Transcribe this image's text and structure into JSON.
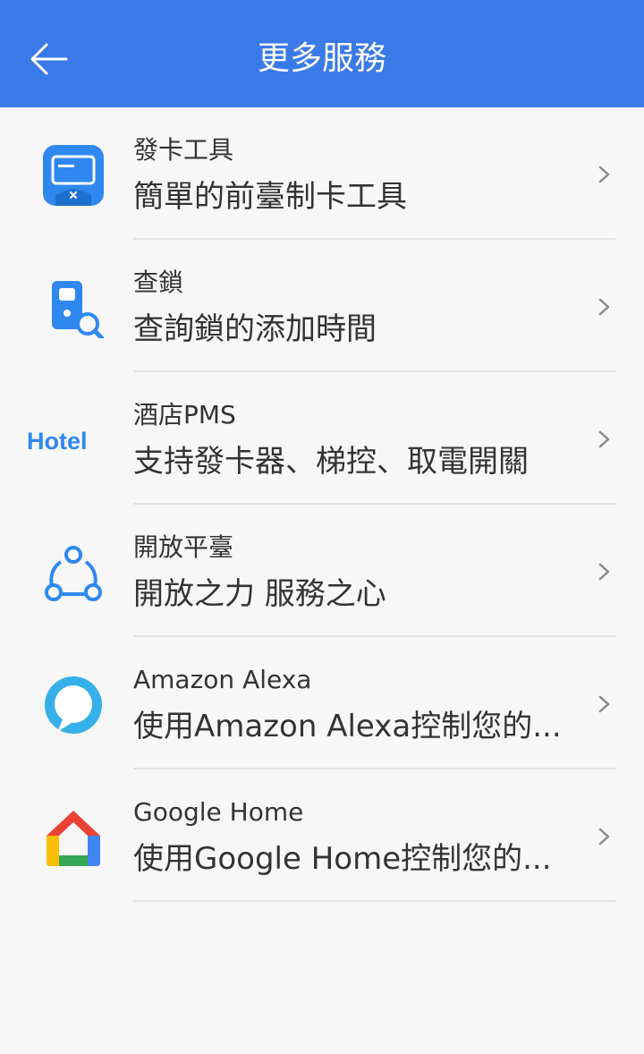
{
  "header": {
    "back_icon": "arrow-left-icon",
    "title": "更多服務",
    "background": "#3a7ae8"
  },
  "services": [
    {
      "icon": "card-tool-icon",
      "title": "發卡工具",
      "description": "簡單的前臺制卡工具"
    },
    {
      "icon": "lock-search-icon",
      "title": "查鎖",
      "description": "查詢鎖的添加時間"
    },
    {
      "icon": "hotel-logo-icon",
      "title": "酒店PMS",
      "description": "支持發卡器、梯控、取電開關",
      "logo_text": "Hotel"
    },
    {
      "icon": "open-platform-icon",
      "title": "開放平臺",
      "description": "開放之力 服務之心"
    },
    {
      "icon": "alexa-icon",
      "title": "Amazon Alexa",
      "description": "使用Amazon Alexa控制您的..."
    },
    {
      "icon": "google-home-icon",
      "title": "Google Home",
      "description": "使用Google Home控制您的..."
    }
  ],
  "colors": {
    "accent": "#3a7ae8",
    "icon_blue": "#2f88f0",
    "text": "#333333",
    "divider": "#e2e2e2",
    "background": "#f7f7f7"
  }
}
